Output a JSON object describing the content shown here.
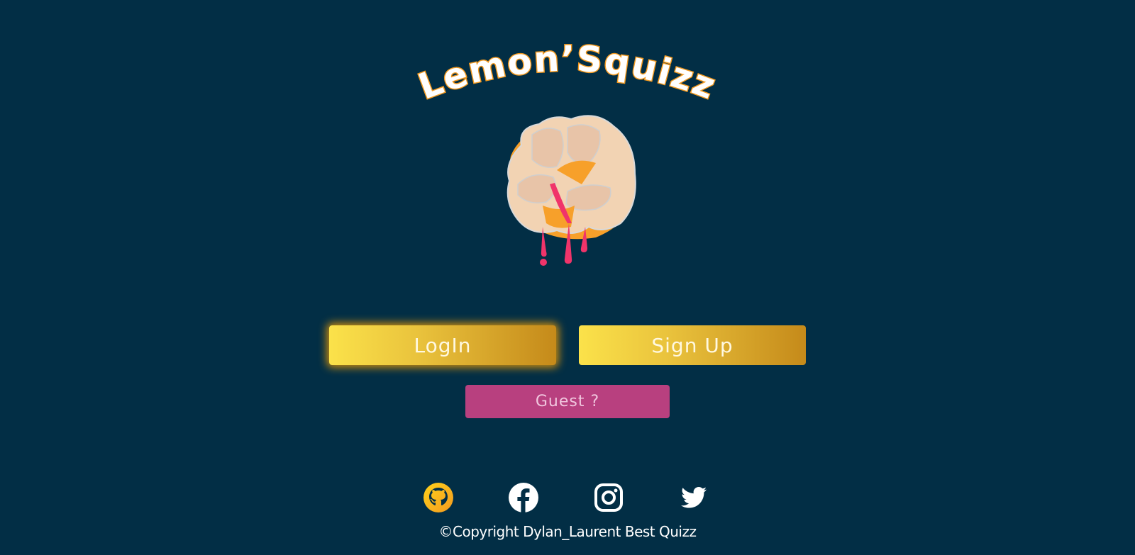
{
  "app": {
    "title": "Lemon’Squizz"
  },
  "buttons": {
    "login_label": "LogIn",
    "signup_label": "Sign Up",
    "guest_label": "Guest ?"
  },
  "socials": [
    {
      "name": "github",
      "icon": "github-icon"
    },
    {
      "name": "facebook",
      "icon": "facebook-icon"
    },
    {
      "name": "instagram",
      "icon": "instagram-icon"
    },
    {
      "name": "twitter",
      "icon": "twitter-icon"
    }
  ],
  "footer": {
    "copyright": "©Copyright Dylan_Laurent Best Quizz"
  },
  "colors": {
    "background": "#022e45",
    "accent": "#f39a20",
    "gold_start": "#fbe24a",
    "gold_end": "#c58a1a",
    "guest": "#b8407f"
  }
}
